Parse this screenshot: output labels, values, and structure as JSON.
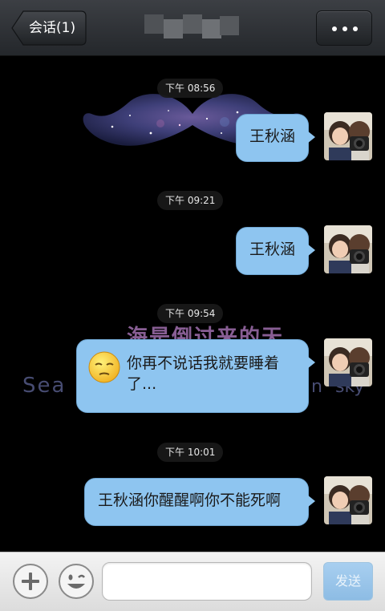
{
  "header": {
    "back_label": "会话(1)",
    "title": "",
    "more_icon": "more-dots-icon"
  },
  "wallpaper": {
    "chinese_text": "海是倒过来的天",
    "sea_word": "Sea",
    "n_letter": "n",
    "sky_word": "sky"
  },
  "messages": [
    {
      "time": "下午 08:56",
      "text": "王秋涵"
    },
    {
      "time": "下午 09:21",
      "text": "王秋涵"
    },
    {
      "time": "下午 09:54",
      "text": "你再不说话我就要睡着了...",
      "emoji": "sleepy-face-icon"
    },
    {
      "time": "下午 10:01",
      "text": "王秋涵你醒醒啊你不能死啊"
    }
  ],
  "input_bar": {
    "plus_icon": "plus-icon",
    "smiley_icon": "smiley-icon",
    "input_value": "",
    "input_placeholder": "",
    "send_label": "发送"
  },
  "colors": {
    "bubble": "#8ec5f0",
    "header": "#2f3236",
    "send_button": "#9cc7ec",
    "chat_background": "#000000"
  }
}
